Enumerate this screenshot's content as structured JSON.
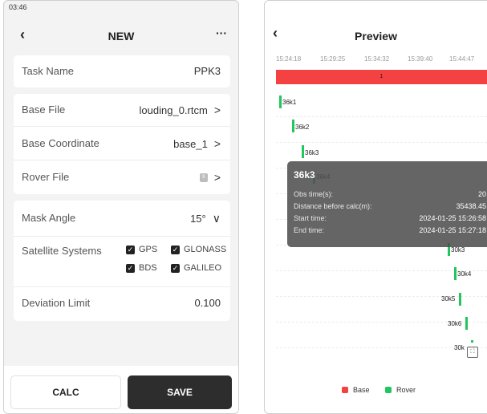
{
  "left": {
    "status_time": "03:46",
    "header": {
      "back": "‹",
      "title": "NEW",
      "more": "···"
    },
    "task": {
      "label": "Task Name",
      "value": "PPK3"
    },
    "files": [
      {
        "label": "Base File",
        "value": "louding_0.rtcm"
      },
      {
        "label": "Base Coordinate",
        "value": "base_1"
      },
      {
        "label": "Rover File",
        "value": "",
        "icon": "file-icon",
        "icon_text": "9"
      }
    ],
    "mask": {
      "label": "Mask Angle",
      "value": "15°"
    },
    "satellites": {
      "label": "Satellite Systems",
      "options": [
        {
          "name": "GPS",
          "checked": true
        },
        {
          "name": "GLONASS",
          "checked": true
        },
        {
          "name": "BDS",
          "checked": true
        },
        {
          "name": "GALILEO",
          "checked": true
        }
      ]
    },
    "deviation": {
      "label": "Deviation Limit",
      "value": "0.100"
    },
    "buttons": {
      "calc": "CALC",
      "save": "SAVE"
    }
  },
  "right": {
    "header": {
      "back": "‹",
      "title": "Preview"
    },
    "ticks": [
      "15:24:18",
      "15:29:25",
      "15:34:32",
      "15:39:40",
      "15:44:47"
    ],
    "base_bar_label": "1",
    "rovers": [
      "36k1",
      "36k2",
      "36k3",
      "36k4",
      "30k3",
      "30k4",
      "30k5",
      "30k6",
      "30k"
    ],
    "tooltip": {
      "title": "36k3",
      "rows": [
        {
          "label": "Obs time(s):",
          "value": "20"
        },
        {
          "label": "Distance before calc(m):",
          "value": "35438.45"
        },
        {
          "label": "Start time:",
          "value": "2024-01-25 15:26:58"
        },
        {
          "label": "End time:",
          "value": "2024-01-25 15:27:18"
        }
      ]
    },
    "legend": {
      "base": "Base",
      "rover": "Rover"
    },
    "colors": {
      "base": "#f44141",
      "rover": "#22c55e"
    },
    "fullscreen_icon": "fullscreen-icon"
  }
}
